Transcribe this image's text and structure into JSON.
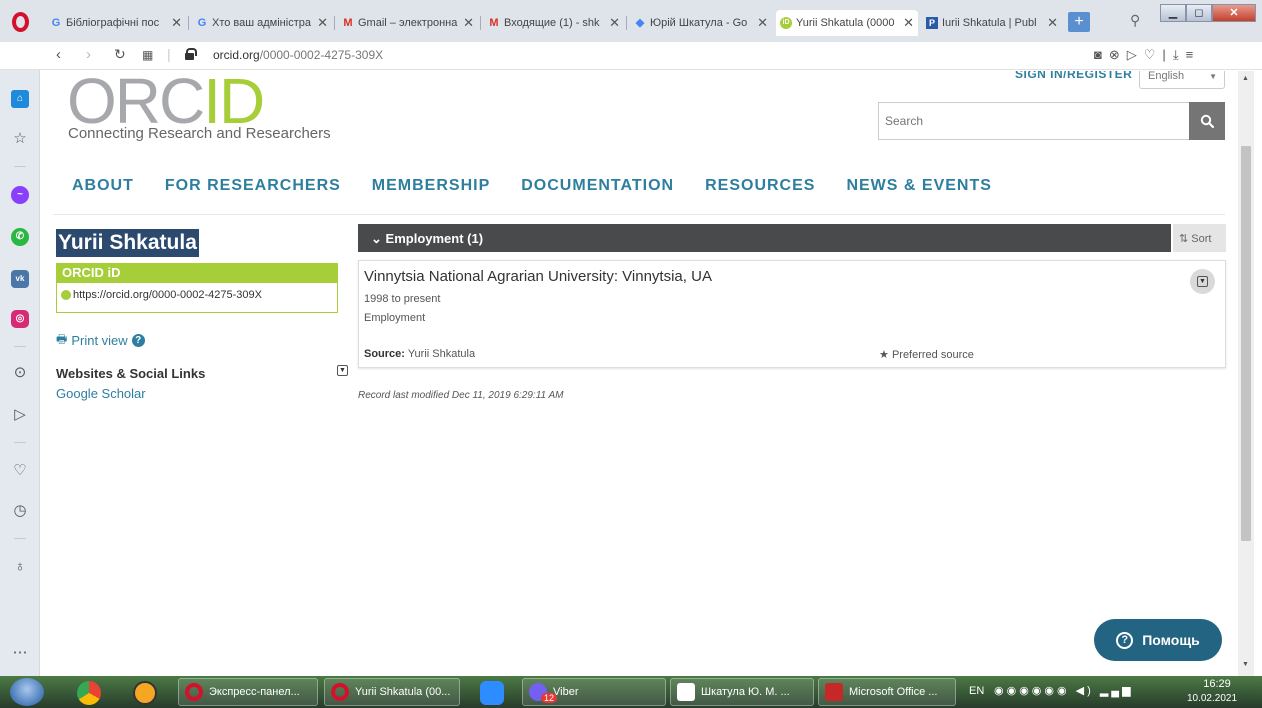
{
  "browser": {
    "tabs": [
      {
        "title": "Бібліографічні пос",
        "icon": "google-icon",
        "active": false
      },
      {
        "title": "Хто ваш адміністра",
        "icon": "google-icon",
        "active": false
      },
      {
        "title": "Gmail – электронна",
        "icon": "gmail-icon",
        "active": false
      },
      {
        "title": "Входящие (1) - shk",
        "icon": "gmail-icon",
        "active": false
      },
      {
        "title": "Юрій Шкатула - Go",
        "icon": "scholar-icon",
        "active": false
      },
      {
        "title": "Yurii Shkatula (0000",
        "icon": "orcid-icon",
        "active": true
      },
      {
        "title": "Iurii Shkatula | Publ",
        "icon": "publons-icon",
        "active": false
      }
    ],
    "newtab_label": "+",
    "url_domain": "orcid.org",
    "url_path": "/0000-0002-4275-309X",
    "window_controls": {
      "minimize": "▁",
      "maximize": "◻",
      "close": "✕"
    }
  },
  "header": {
    "logo_orc": "ORC",
    "logo_id": "ID",
    "tagline": "Connecting Research and Researchers",
    "signin": "SIGN IN/REGISTER",
    "language": "English",
    "search_placeholder": "Search"
  },
  "nav": {
    "items": [
      "ABOUT",
      "FOR RESEARCHERS",
      "MEMBERSHIP",
      "DOCUMENTATION",
      "RESOURCES",
      "NEWS & EVENTS"
    ]
  },
  "profile": {
    "name": "Yurii Shkatula",
    "orcid_label": "ORCID iD",
    "orcid_url": "https://orcid.org/0000-0002-4275-309X",
    "print_view": "Print view",
    "websites_header": "Websites & Social Links",
    "websites": [
      "Google Scholar"
    ]
  },
  "employment": {
    "header": "Employment (1)",
    "sort_label": "Sort",
    "items": [
      {
        "title": "Vinnytsia National Agrarian University: Vinnytsia, UA",
        "dates": "1998 to present",
        "type": "Employment",
        "source_label": "Source:",
        "source_value": "Yurii Shkatula",
        "preferred": "Preferred source"
      }
    ],
    "record_modified": "Record last modified Dec 11, 2019 6:29:11 AM"
  },
  "help_button": "Помощь",
  "taskbar": {
    "buttons": [
      "Экспресс-панел...",
      "Yurii Shkatula (00...",
      "Viber",
      "Шкатула Ю. М. ...",
      "Microsoft Office ..."
    ],
    "viber_badge": "12",
    "lang": "EN",
    "time": "16:29",
    "date": "10.02.2021"
  },
  "colors": {
    "orcid_green": "#a6ce39",
    "orcid_gray": "#a6a8ab",
    "link_blue": "#2e7f9f",
    "name_highlight": "#2c4a6e",
    "employment_bar": "#494a4c",
    "help_button": "#246483"
  }
}
